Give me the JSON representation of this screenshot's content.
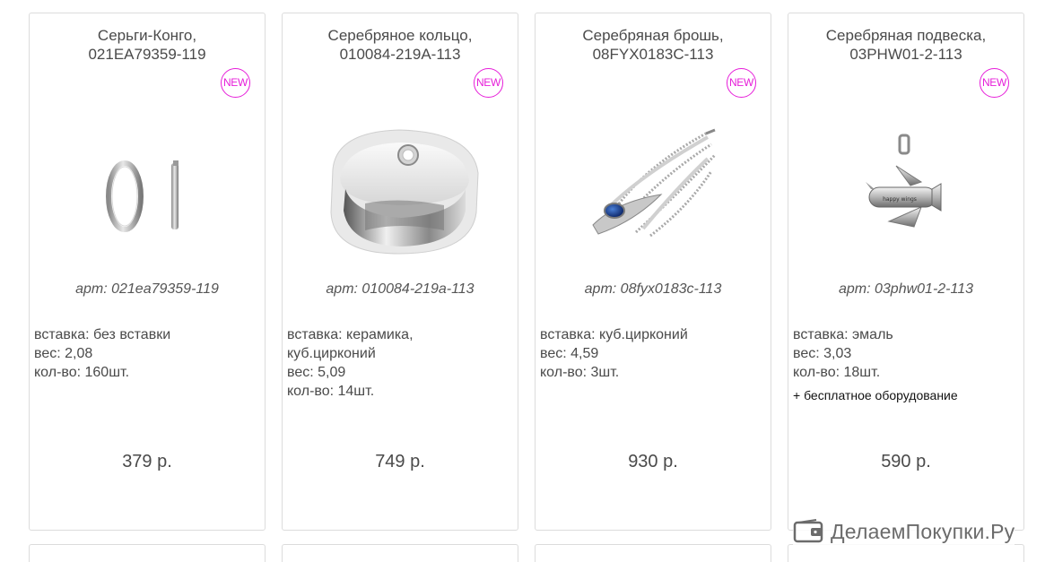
{
  "products": [
    {
      "title_line1": "Серьги-Конго,",
      "title_line2": "021EA79359-119",
      "badge": "NEW",
      "image_icon": "hoop-earrings-image",
      "article": "арт: 021ea79359-119",
      "specs": [
        "вставка: без вставки",
        "вес: 2,08",
        "кол-во: 160шт."
      ],
      "extra": "",
      "price": "379 р."
    },
    {
      "title_line1": "Серебряное кольцо,",
      "title_line2": "010084-219A-113",
      "badge": "NEW",
      "image_icon": "ceramic-ring-image",
      "article": "арт: 010084-219a-113",
      "specs": [
        "вставка: керамика,",
        "куб.цирконий",
        "вес: 5,09",
        "кол-во: 14шт."
      ],
      "extra": "",
      "price": "749 р."
    },
    {
      "title_line1": "Серебряная брошь,",
      "title_line2": "08FYX0183C-113",
      "badge": "NEW",
      "image_icon": "feather-brooch-image",
      "article": "арт: 08fyx0183c-113",
      "specs": [
        "вставка: куб.цирконий",
        "вес: 4,59",
        "кол-во: 3шт."
      ],
      "extra": "",
      "price": "930 р."
    },
    {
      "title_line1": "Серебряная подвеска,",
      "title_line2": "03PHW01-2-113",
      "badge": "NEW",
      "image_icon": "airplane-pendant-image",
      "image_text": "happy wings",
      "article": "арт: 03phw01-2-113",
      "specs": [
        "вставка: эмаль",
        "вес: 3,03",
        "кол-во: 18шт."
      ],
      "extra": "+ бесплатное оборудование",
      "price": "590 р."
    }
  ],
  "watermark": {
    "text": "ДелаемПокупки.Ру",
    "icon": "wallet-icon"
  }
}
